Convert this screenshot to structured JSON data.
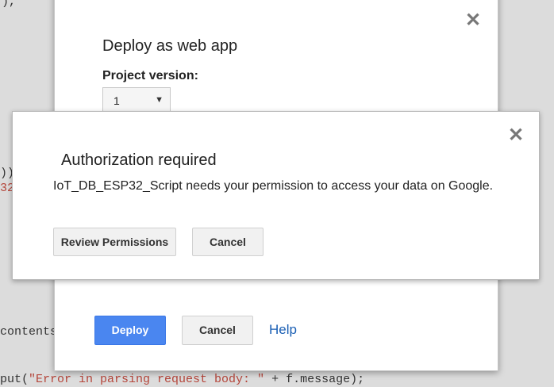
{
  "background_code": {
    "line1": "),",
    "line2": "))",
    "line3": "32",
    "line4": "contents",
    "line5_prefix": "put(",
    "line5_string": "\"Error in parsing request body: \"",
    "line5_suffix": " + f.message);"
  },
  "deploy_dialog": {
    "title": "Deploy as web app",
    "close_glyph": "✕",
    "project_version_label": "Project version:",
    "version_value": "1",
    "dropdown_glyph": "▼",
    "deploy_label": "Deploy",
    "cancel_label": "Cancel",
    "help_label": "Help"
  },
  "auth_dialog": {
    "title": "Authorization required",
    "close_glyph": "✕",
    "message": "IoT_DB_ESP32_Script needs your permission to access your data on Google.",
    "review_label": "Review Permissions",
    "cancel_label": "Cancel"
  },
  "colors": {
    "primary_button": "#4a86f0",
    "link": "#1a5fb4",
    "background": "#dcdcdc"
  }
}
